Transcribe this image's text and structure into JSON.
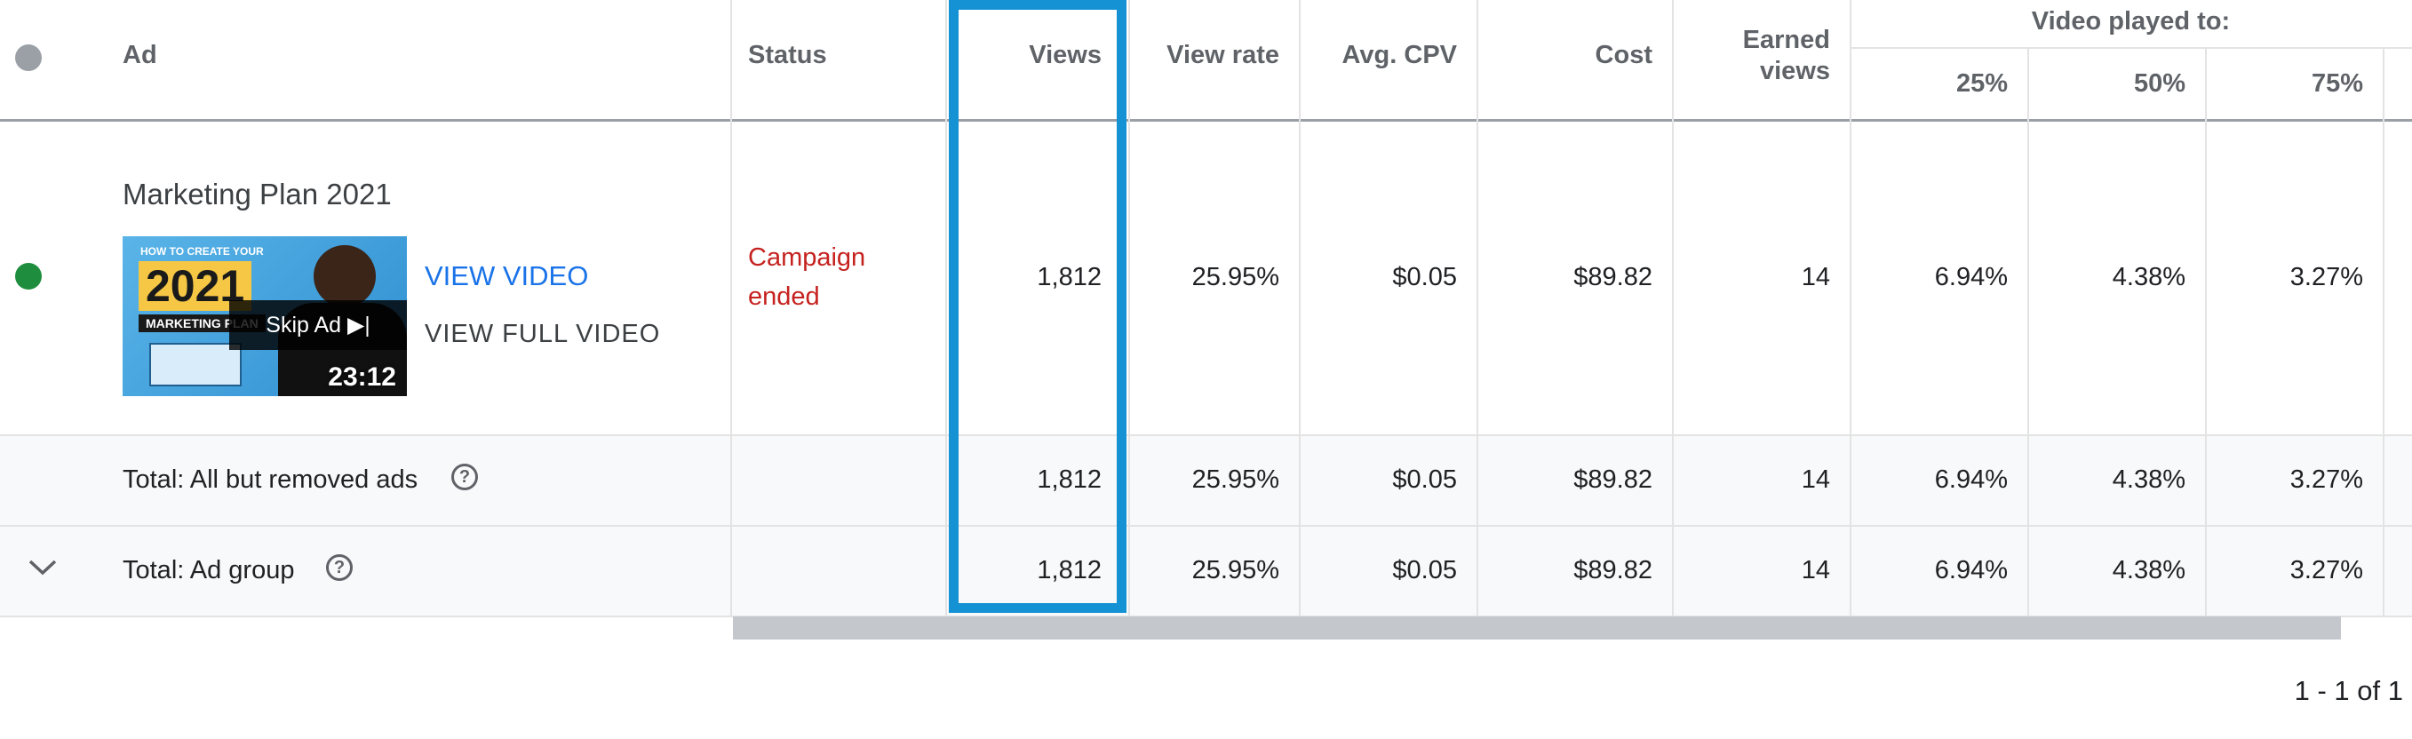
{
  "header": {
    "ad": "Ad",
    "status": "Status",
    "views": "Views",
    "view_rate": "View rate",
    "avg_cpv": "Avg. CPV",
    "cost": "Cost",
    "earned_views_line1": "Earned",
    "earned_views_line2": "views",
    "video_played_to": "Video played to:",
    "p25": "25%",
    "p50": "50%",
    "p75": "75%"
  },
  "ad_row": {
    "title": "Marketing Plan 2021",
    "view_video": "VIEW VIDEO",
    "view_full_video": "VIEW FULL VIDEO",
    "status_line1": "Campaign",
    "status_line2": "ended",
    "views": "1,812",
    "view_rate": "25.95%",
    "avg_cpv": "$0.05",
    "cost": "$89.82",
    "earned_views": "14",
    "p25": "6.94%",
    "p50": "4.38%",
    "p75": "3.27%",
    "thumbnail": {
      "top_text": "HOW TO CREATE YOUR",
      "year": "2021",
      "banner": "MARKETING PLAN",
      "skip": "Skip Ad ▶|",
      "duration": "23:12"
    }
  },
  "total_all": {
    "label": "Total: All but removed ads",
    "views": "1,812",
    "view_rate": "25.95%",
    "avg_cpv": "$0.05",
    "cost": "$89.82",
    "earned_views": "14",
    "p25": "6.94%",
    "p50": "4.38%",
    "p75": "3.27%"
  },
  "total_group": {
    "label": "Total: Ad group",
    "views": "1,812",
    "view_rate": "25.95%",
    "avg_cpv": "$0.05",
    "cost": "$89.82",
    "earned_views": "14",
    "p25": "6.94%",
    "p50": "4.38%",
    "p75": "3.27%"
  },
  "pagination": "1 - 1 of 1",
  "icons": {
    "help": "?",
    "expand": "chevron-down-icon"
  },
  "colors": {
    "status_ended": "#c5221f",
    "active_dot": "#1e8e3e",
    "link": "#1a73e8",
    "highlight": "#1592d4"
  }
}
